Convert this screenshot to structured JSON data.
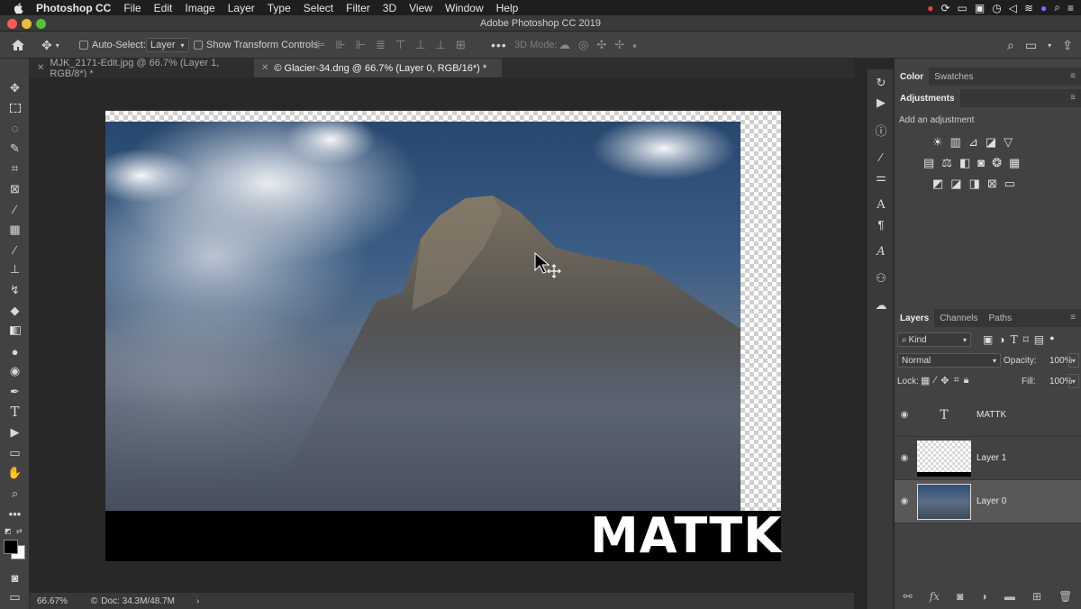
{
  "menubar": {
    "app_name": "Photoshop CC",
    "items": [
      "File",
      "Edit",
      "Image",
      "Layer",
      "Type",
      "Select",
      "Filter",
      "3D",
      "View",
      "Window",
      "Help"
    ]
  },
  "window": {
    "title": "Adobe Photoshop CC 2019"
  },
  "options": {
    "auto_select_label": "Auto-Select:",
    "auto_select_value": "Layer",
    "show_transform_label": "Show Transform Controls",
    "mode_3d_label": "3D Mode:"
  },
  "tabs": [
    {
      "label": "MJK_2171-Edit.jpg @ 66.7% (Layer 1, RGB/8*) *",
      "active": false
    },
    {
      "label": "© Glacier-34.dng @ 66.7% (Layer 0, RGB/16*) *",
      "active": true
    }
  ],
  "canvas": {
    "overlay_text": "MATTK"
  },
  "status": {
    "zoom": "66.67%",
    "doc": "Doc: 34.3M/48.7M"
  },
  "panels": {
    "color_tabs": [
      "Color",
      "Swatches"
    ],
    "adjustments_tab": "Adjustments",
    "adjustments_hint": "Add an adjustment",
    "layers_tabs": [
      "Layers",
      "Channels",
      "Paths"
    ],
    "filter_kind": "Kind",
    "blend_mode": "Normal",
    "opacity_label": "Opacity:",
    "opacity_value": "100%",
    "lock_label": "Lock:",
    "fill_label": "Fill:",
    "fill_value": "100%"
  },
  "layers": [
    {
      "name": "MATTK",
      "type": "text"
    },
    {
      "name": "Layer 1",
      "type": "pixel"
    },
    {
      "name": "Layer 0",
      "type": "image",
      "selected": true
    }
  ],
  "colors": {
    "accent_blue": "#2f6fd3",
    "panel_bg": "#424242",
    "canvas_bg": "#282828"
  }
}
